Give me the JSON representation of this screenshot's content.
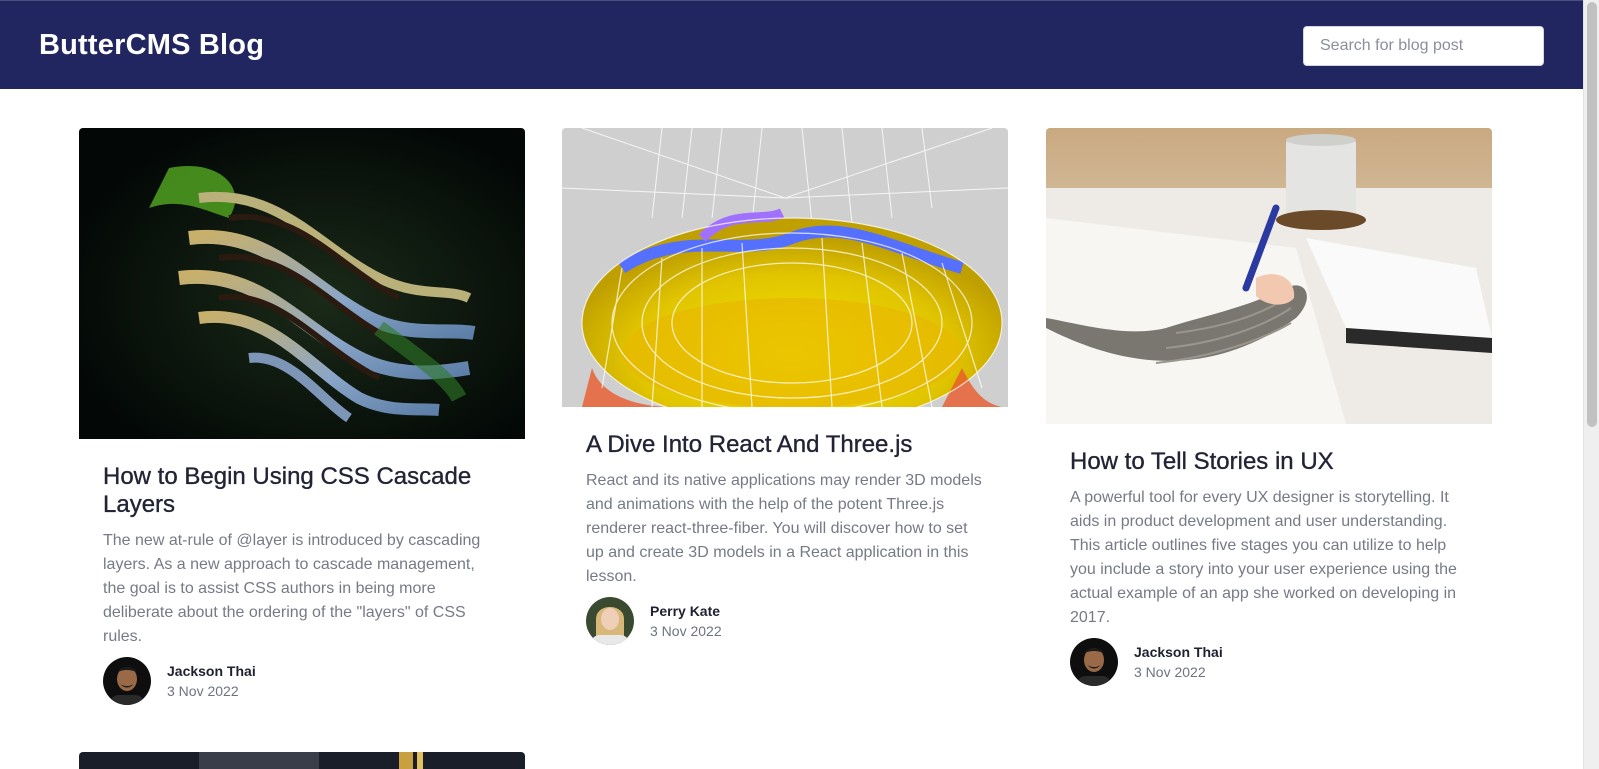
{
  "header": {
    "brand": "ButterCMS Blog",
    "search_placeholder": "Search for blog post"
  },
  "posts": [
    {
      "title": "How to Begin Using CSS Cascade Layers",
      "excerpt": "The new at-rule of @layer is introduced by cascading layers. As a new approach to cascade management, the goal is to assist CSS authors in being more deliberate about the ordering of the \"layers\" of CSS rules.",
      "author": "Jackson Thai",
      "date": "3 Nov 2022",
      "image_icon": "rice-terraces-photo"
    },
    {
      "title": "A Dive Into React And Three.js",
      "excerpt": "React and its native applications may render 3D models and animations with the help of the potent Three.js renderer react-three-fiber. You will discover how to set up and create 3D models in a React application in this lesson.",
      "author": "Perry Kate",
      "date": "3 Nov 2022",
      "image_icon": "3d-wireframe-photo"
    },
    {
      "title": "How to Tell Stories in UX",
      "excerpt": "A powerful tool for every UX designer is storytelling. It aids in product development and user understanding. This article outlines five stages you can utilize to help you include a story into your user experience using the actual example of an app she worked on developing in 2017.",
      "author": "Jackson Thai",
      "date": "3 Nov 2022",
      "image_icon": "writing-notebook-photo"
    }
  ],
  "colors": {
    "header_bg": "#222660",
    "title": "#222436",
    "excerpt": "#767a85"
  }
}
